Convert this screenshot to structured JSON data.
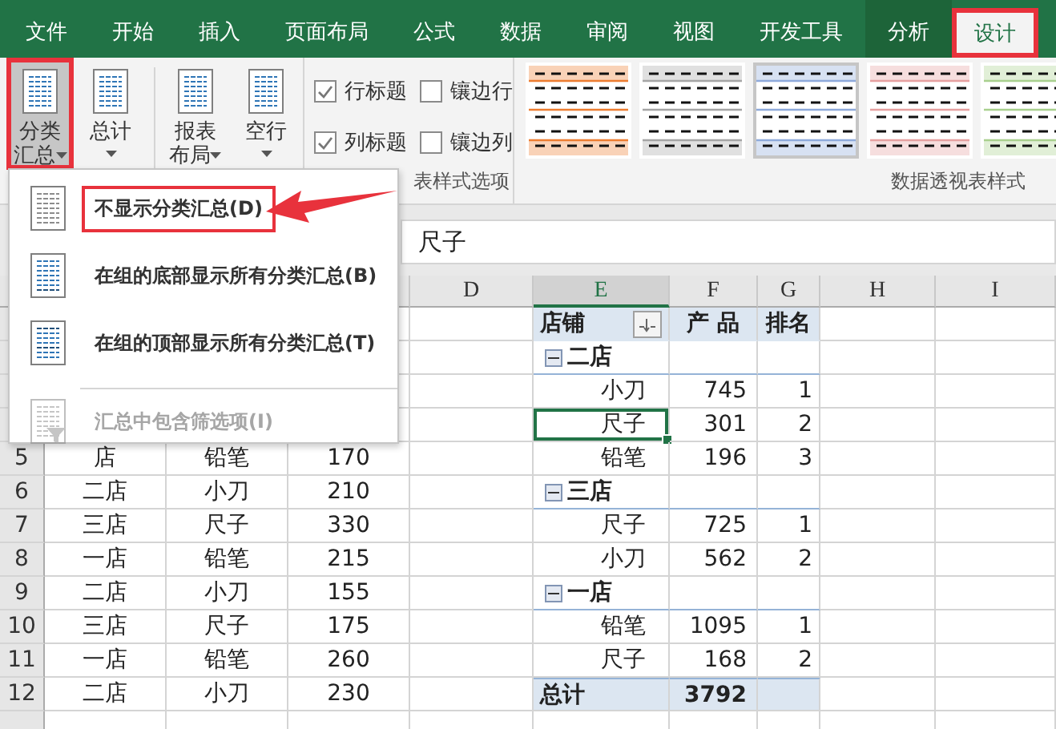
{
  "ribbon_tabs": [
    {
      "label": "文件",
      "selected": false,
      "contextual": false,
      "highlighted": false
    },
    {
      "label": "开始",
      "selected": false,
      "contextual": false,
      "highlighted": false
    },
    {
      "label": "插入",
      "selected": false,
      "contextual": false,
      "highlighted": false
    },
    {
      "label": "页面布局",
      "selected": false,
      "contextual": false,
      "highlighted": false
    },
    {
      "label": "公式",
      "selected": false,
      "contextual": false,
      "highlighted": false
    },
    {
      "label": "数据",
      "selected": false,
      "contextual": false,
      "highlighted": false
    },
    {
      "label": "审阅",
      "selected": false,
      "contextual": false,
      "highlighted": false
    },
    {
      "label": "视图",
      "selected": false,
      "contextual": false,
      "highlighted": false
    },
    {
      "label": "开发工具",
      "selected": false,
      "contextual": false,
      "highlighted": false
    },
    {
      "label": "分析",
      "selected": false,
      "contextual": true,
      "highlighted": false
    },
    {
      "label": "设计",
      "selected": true,
      "contextual": true,
      "highlighted": true
    }
  ],
  "ribbon": {
    "buttons": [
      {
        "label": "分类汇总",
        "pressed": true,
        "highlighted": true
      },
      {
        "label": "总计",
        "pressed": false,
        "highlighted": false
      },
      {
        "label": "报表布局",
        "pressed": false,
        "highlighted": false
      },
      {
        "label": "空行",
        "pressed": false,
        "highlighted": false
      }
    ],
    "options": [
      {
        "label": "行标题",
        "checked": true
      },
      {
        "label": "镶边行",
        "checked": false
      },
      {
        "label": "列标题",
        "checked": true
      },
      {
        "label": "镶边列",
        "checked": false
      }
    ],
    "options_group_label": "表样式选项",
    "styles": [
      {
        "color": "#ed7d31",
        "selected": false
      },
      {
        "color": "#a5a5a5",
        "selected": false
      },
      {
        "color": "#8eaadb",
        "selected": true
      },
      {
        "color": "#e6a0a0",
        "selected": false
      },
      {
        "color": "#a9d08e",
        "selected": false
      }
    ],
    "styles_group_label": "数据透视表样式"
  },
  "subtotal_menu": {
    "items": [
      {
        "label": "不显示分类汇总(D)",
        "kind": "none",
        "highlighted": true,
        "disabled": false
      },
      {
        "label": "在组的底部显示所有分类汇总(B)",
        "kind": "bottom",
        "highlighted": false,
        "disabled": false
      },
      {
        "label": "在组的顶部显示所有分类汇总(T)",
        "kind": "top",
        "highlighted": false,
        "disabled": false
      },
      {
        "label": "汇总中包含筛选项(I)",
        "kind": "filter",
        "highlighted": false,
        "disabled": true
      }
    ]
  },
  "formula_bar": {
    "value": "尺子"
  },
  "columns": [
    {
      "label": "D",
      "selected": false
    },
    {
      "label": "E",
      "selected": true
    },
    {
      "label": "F",
      "selected": false
    },
    {
      "label": "G",
      "selected": false
    },
    {
      "label": "H",
      "selected": false
    },
    {
      "label": "I",
      "selected": false
    }
  ],
  "sheet_rows": [
    {
      "number": "5",
      "cells": [
        "店",
        "铅笔",
        "170"
      ]
    },
    {
      "number": "6",
      "cells": [
        "二店",
        "小刀",
        "210"
      ]
    },
    {
      "number": "7",
      "cells": [
        "三店",
        "尺子",
        "330"
      ]
    },
    {
      "number": "8",
      "cells": [
        "一店",
        "铅笔",
        "215"
      ]
    },
    {
      "number": "9",
      "cells": [
        "二店",
        "小刀",
        "155"
      ]
    },
    {
      "number": "10",
      "cells": [
        "三店",
        "尺子",
        "175"
      ]
    },
    {
      "number": "11",
      "cells": [
        "一店",
        "铅笔",
        "260"
      ]
    },
    {
      "number": "12",
      "cells": [
        "二店",
        "小刀",
        "230"
      ]
    }
  ],
  "pivot": {
    "headers": [
      "店铺",
      "产 品",
      "排名"
    ],
    "groups": [
      {
        "name": "二店",
        "expanded": true,
        "items": [
          {
            "product": "小刀",
            "value": "745",
            "rank": "1",
            "selected": false
          },
          {
            "product": "尺子",
            "value": "301",
            "rank": "2",
            "selected": true
          },
          {
            "product": "铅笔",
            "value": "196",
            "rank": "3",
            "selected": false
          }
        ]
      },
      {
        "name": "三店",
        "expanded": true,
        "items": [
          {
            "product": "尺子",
            "value": "725",
            "rank": "1",
            "selected": false
          },
          {
            "product": "小刀",
            "value": "562",
            "rank": "2",
            "selected": false
          }
        ]
      },
      {
        "name": "一店",
        "expanded": true,
        "items": [
          {
            "product": "铅笔",
            "value": "1095",
            "rank": "1",
            "selected": false
          },
          {
            "product": "尺子",
            "value": "168",
            "rank": "2",
            "selected": false
          }
        ]
      }
    ],
    "total": {
      "label": "总计",
      "value": "3792"
    }
  }
}
